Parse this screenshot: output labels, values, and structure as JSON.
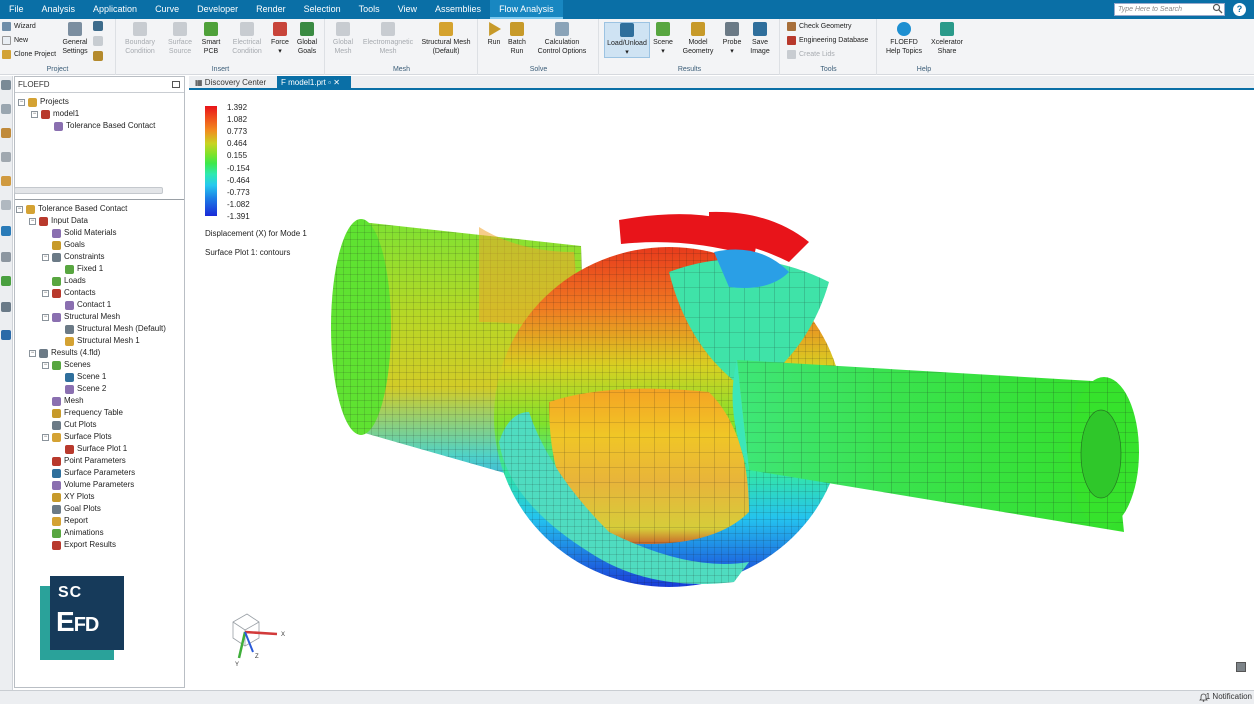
{
  "menu": [
    "File",
    "Analysis",
    "Application",
    "Curve",
    "Developer",
    "Render",
    "Selection",
    "Tools",
    "View",
    "Assemblies",
    "Flow Analysis"
  ],
  "menu_active": "Flow Analysis",
  "search": {
    "placeholder": "Type Here to Search"
  },
  "ribbon": {
    "project": {
      "label": "Project",
      "wizard": "Wizard",
      "new": "New",
      "clone": "Clone Project",
      "general_1": "General",
      "general_2": "Settings"
    },
    "insert": {
      "label": "Insert",
      "boundary_1": "Boundary",
      "boundary_2": "Condition",
      "surface_1": "Surface",
      "surface_2": "Source",
      "smart_1": "Smart",
      "smart_2": "PCB",
      "electrical_1": "Electrical",
      "electrical_2": "Condition",
      "force": "Force",
      "goals_1": "Global",
      "goals_2": "Goals"
    },
    "mesh": {
      "label": "Mesh",
      "global_1": "Global",
      "global_2": "Mesh",
      "em_1": "Electromagnetic",
      "em_2": "Mesh",
      "structural_1": "Structural Mesh",
      "structural_2": "(Default)"
    },
    "solve": {
      "label": "Solve",
      "run": "Run",
      "batch_1": "Batch",
      "batch_2": "Run",
      "calc_1": "Calculation",
      "calc_2": "Control Options"
    },
    "results": {
      "label": "Results",
      "load": "Load/Unload",
      "scene": "Scene",
      "model_1": "Model",
      "model_2": "Geometry",
      "probe": "Probe",
      "save_1": "Save",
      "save_2": "Image"
    },
    "tools": {
      "label": "Tools",
      "check": "Check Geometry",
      "engdb": "Engineering Database",
      "lids": "Create Lids"
    },
    "help": {
      "label": "Help",
      "floefd_1": "FLOEFD",
      "floefd_2": "Help Topics",
      "xcel_1": "Xcelerator",
      "xcel_2": "Share"
    }
  },
  "panel": {
    "header": "FLOEFD",
    "project_tree": [
      {
        "label": "Projects",
        "level": 0
      },
      {
        "label": "model1",
        "level": 1
      },
      {
        "label": "Tolerance Based Contact",
        "level": 2
      }
    ],
    "analysis_tree": [
      {
        "label": "Tolerance Based Contact",
        "level": 0
      },
      {
        "label": "Input Data",
        "level": 1
      },
      {
        "label": "Solid Materials",
        "level": 2
      },
      {
        "label": "Goals",
        "level": 2
      },
      {
        "label": "Constraints",
        "level": 2
      },
      {
        "label": "Fixed 1",
        "level": 3
      },
      {
        "label": "Loads",
        "level": 2
      },
      {
        "label": "Contacts",
        "level": 2
      },
      {
        "label": "Contact 1",
        "level": 3
      },
      {
        "label": "Structural Mesh",
        "level": 2
      },
      {
        "label": "Structural Mesh (Default)",
        "level": 3
      },
      {
        "label": "Structural Mesh 1",
        "level": 3
      },
      {
        "label": "Results (4.fld)",
        "level": 1
      },
      {
        "label": "Scenes",
        "level": 2
      },
      {
        "label": "Scene 1",
        "level": 3
      },
      {
        "label": "Scene 2",
        "level": 3
      },
      {
        "label": "Mesh",
        "level": 2
      },
      {
        "label": "Frequency Table",
        "level": 2
      },
      {
        "label": "Cut Plots",
        "level": 2
      },
      {
        "label": "Surface Plots",
        "level": 2
      },
      {
        "label": "Surface Plot 1",
        "level": 3
      },
      {
        "label": "Point Parameters",
        "level": 2
      },
      {
        "label": "Surface Parameters",
        "level": 2
      },
      {
        "label": "Volume Parameters",
        "level": 2
      },
      {
        "label": "XY Plots",
        "level": 2
      },
      {
        "label": "Goal Plots",
        "level": 2
      },
      {
        "label": "Report",
        "level": 2
      },
      {
        "label": "Animations",
        "level": 2
      },
      {
        "label": "Export Results",
        "level": 2
      }
    ]
  },
  "logo": {
    "line1": "SC",
    "line2_big": "E",
    "line2_small": "FD"
  },
  "tabs": [
    "Discovery Center",
    "model1.prt"
  ],
  "legend": {
    "values": [
      "1.392",
      "1.082",
      "0.773",
      "0.464",
      "0.155",
      "-0.154",
      "-0.464",
      "-0.773",
      "-1.082",
      "-1.391"
    ],
    "title": "Displacement (X) for Mode 1",
    "subtitle": "Surface Plot 1: contours"
  },
  "triad": {
    "x": "X",
    "y": "Y",
    "z": "Z"
  },
  "status": {
    "text": "1 Notification"
  },
  "colors": {
    "accent": "#0a6fa6",
    "red": "#e8141a",
    "green": "#3ee84a",
    "blue": "#1a2ad8",
    "cyan": "#26c9ef"
  }
}
